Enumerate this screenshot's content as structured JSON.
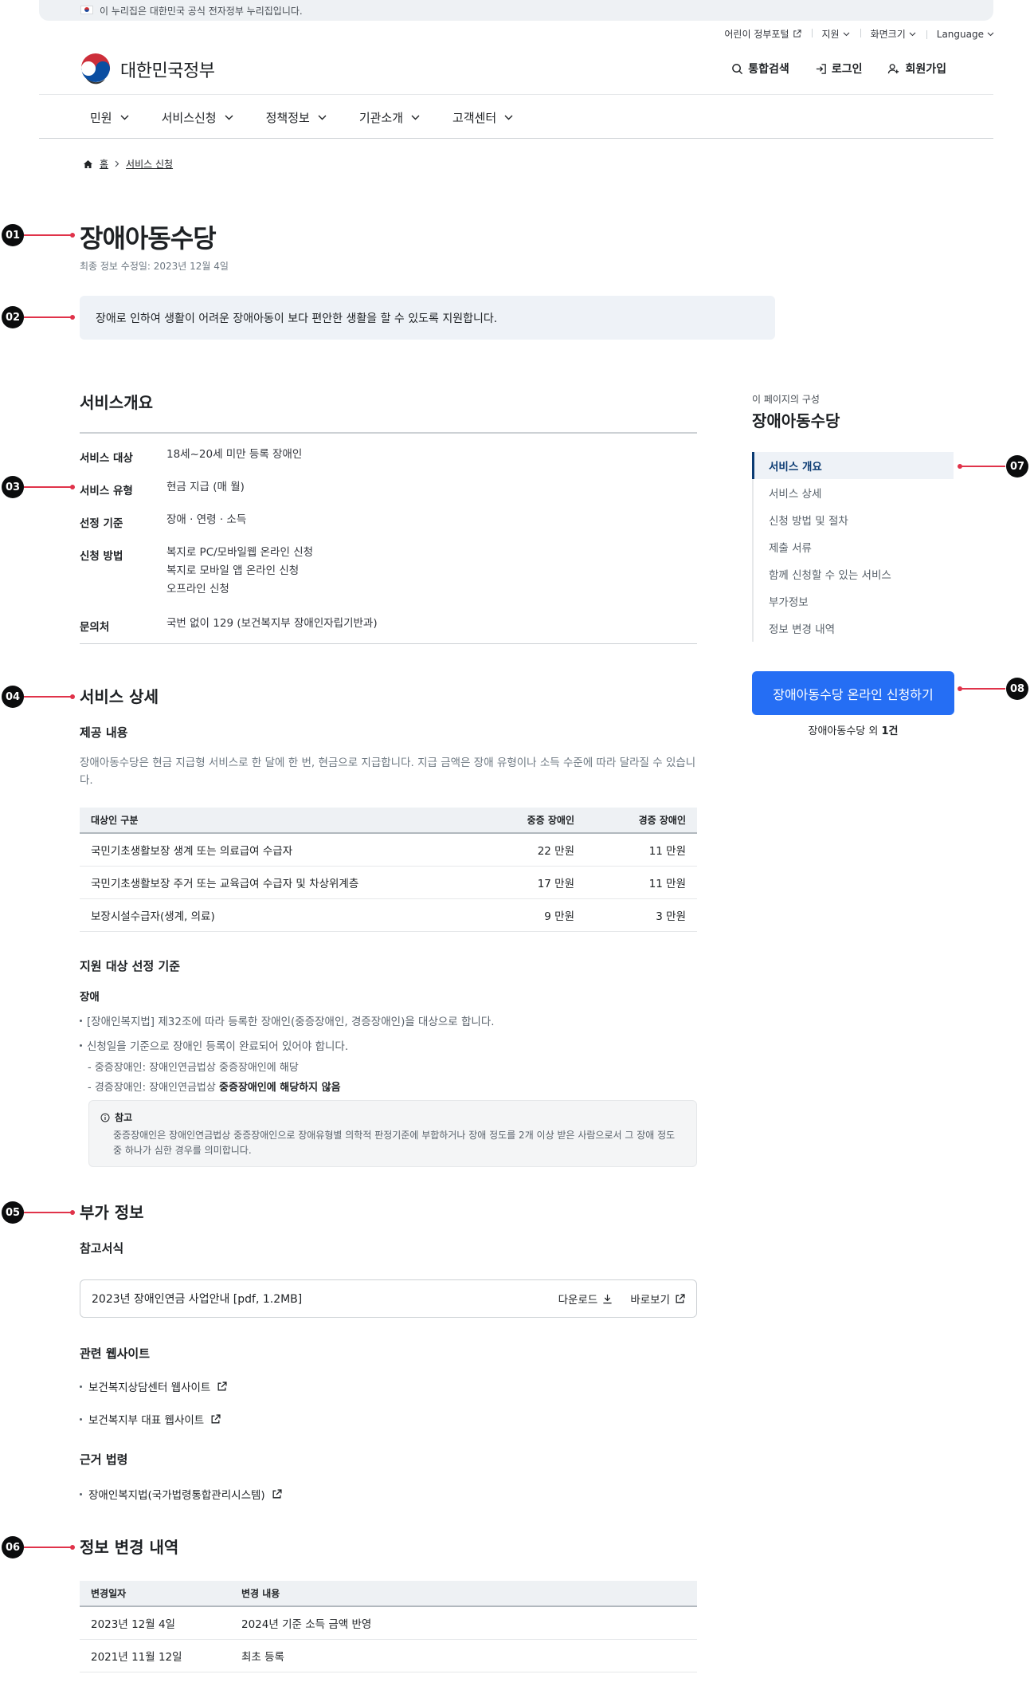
{
  "gov_banner": {
    "text": "이 누리집은 대한민국 공식 전자정부 누리집입니다."
  },
  "utility": {
    "kids_portal": "어린이 정부포털",
    "support": "지원",
    "font_size": "화면크기",
    "language": "Language"
  },
  "header": {
    "logo_text": "대한민국정부",
    "search": "통합검색",
    "login": "로그인",
    "signup": "회원가입"
  },
  "gnb": [
    "민원",
    "서비스신청",
    "정책정보",
    "기관소개",
    "고객센터"
  ],
  "breadcrumb": {
    "home": "홈",
    "current": "서비스 신청"
  },
  "markers": [
    "01",
    "02",
    "03",
    "04",
    "05",
    "06",
    "07",
    "08"
  ],
  "page": {
    "title": "장애아동수당",
    "updated": "최종 정보 수정일: 2023년 12월 4일",
    "summary": "장애로 인하여 생활이 어려운 장애아동이 보다 편안한 생활을 할 수 있도록 지원합니다."
  },
  "overview": {
    "heading": "서비스개요",
    "rows": [
      {
        "label": "서비스 대상",
        "values": [
          "18세~20세 미만 등록 장애인"
        ]
      },
      {
        "label": "서비스 유형",
        "values": [
          "현금 지급 (매 월)"
        ]
      },
      {
        "label": "선정 기준",
        "values": [
          "장애 · 연령 · 소득"
        ]
      },
      {
        "label": "신청 방법",
        "values": [
          "복지로 PC/모바일웹 온라인 신청",
          "복지로 모바일 앱 온라인 신청",
          "오프라인 신청"
        ]
      },
      {
        "label": "문의처",
        "values": [
          "국번 없이 129 (보건복지부 장애인자립기반과)"
        ]
      }
    ]
  },
  "detail": {
    "heading": "서비스 상세",
    "provide_heading": "제공 내용",
    "provide_text": "장애아동수당은 현금 지급형 서비스로 한 달에 한 번, 현금으로 지급합니다. 지급 금액은 장애 유형이나 소득 수준에 따라 달라질 수 있습니다.",
    "table": {
      "headers": [
        "대상인 구분",
        "중증 장애인",
        "경증 장애인"
      ],
      "rows": [
        [
          "국민기초생활보장 생계 또는 의료급여 수급자",
          "22 만원",
          "11 만원"
        ],
        [
          "국민기초생활보장 주거 또는 교육급여 수급자 및 차상위계층",
          "17 만원",
          "11 만원"
        ],
        [
          "보장시설수급자(생계, 의료)",
          "9 만원",
          "3 만원"
        ]
      ]
    },
    "criteria_heading": "지원 대상 선정 기준",
    "criteria_sub": "장애",
    "bullets": [
      "[장애인복지법] 제32조에 따라 등록한 장애인(중증장애인, 경증장애인)을 대상으로 합니다.",
      "신청일을 기준으로 장애인 등록이 완료되어 있어야 합니다."
    ],
    "dash1": "- 중증장애인: 장애인연금법상 중증장애인에 해당",
    "dash2_prefix": "- 경증장애인: 장애인연금법상 ",
    "dash2_bold": "중증장애인에 해당하지 않음",
    "note_title": "참고",
    "note_text": "중증장애인은 장애인연금법상 중증장애인으로 장애유형별 의학적 판정기준에 부합하거나 장애 정도를 2개 이상 받은 사람으로서 그 장애 정도 중 하나가 심한 경우를 의미합니다."
  },
  "extra": {
    "heading": "부가 정보",
    "forms_heading": "참고서식",
    "file_name": "2023년 장애인연금 사업안내 [pdf, 1.2MB]",
    "download": "다운로드",
    "view": "바로보기",
    "sites_heading": "관련 웹사이트",
    "sites": [
      "보건복지상담센터 웹사이트",
      "보건복지부 대표 웹사이트"
    ],
    "law_heading": "근거 법령",
    "laws": [
      "장애인복지법(국가법령통합관리시스템)"
    ]
  },
  "history": {
    "heading": "정보 변경 내역",
    "headers": [
      "변경일자",
      "변경 내용"
    ],
    "rows": [
      [
        "2023년 12월 4일",
        "2024년 기준 소득 금액 반영"
      ],
      [
        "2021년 11월 12일",
        "최초 등록"
      ]
    ]
  },
  "toc": {
    "caption": "이 페이지의 구성",
    "title": "장애아동수당",
    "items": [
      "서비스 개요",
      "서비스 상세",
      "신청 방법 및 절차",
      "제출 서류",
      "함께 신청할 수 있는 서비스",
      "부가정보",
      "정보 변경 내역"
    ]
  },
  "apply": {
    "button": "장애아동수당 온라인 신청하기",
    "sub_prefix": "장애아동수당 외 ",
    "sub_bold": "1건"
  },
  "colors": {
    "primary": "#256ef4",
    "marker_line": "#e0334a",
    "active_nav": "#0b3b73"
  }
}
